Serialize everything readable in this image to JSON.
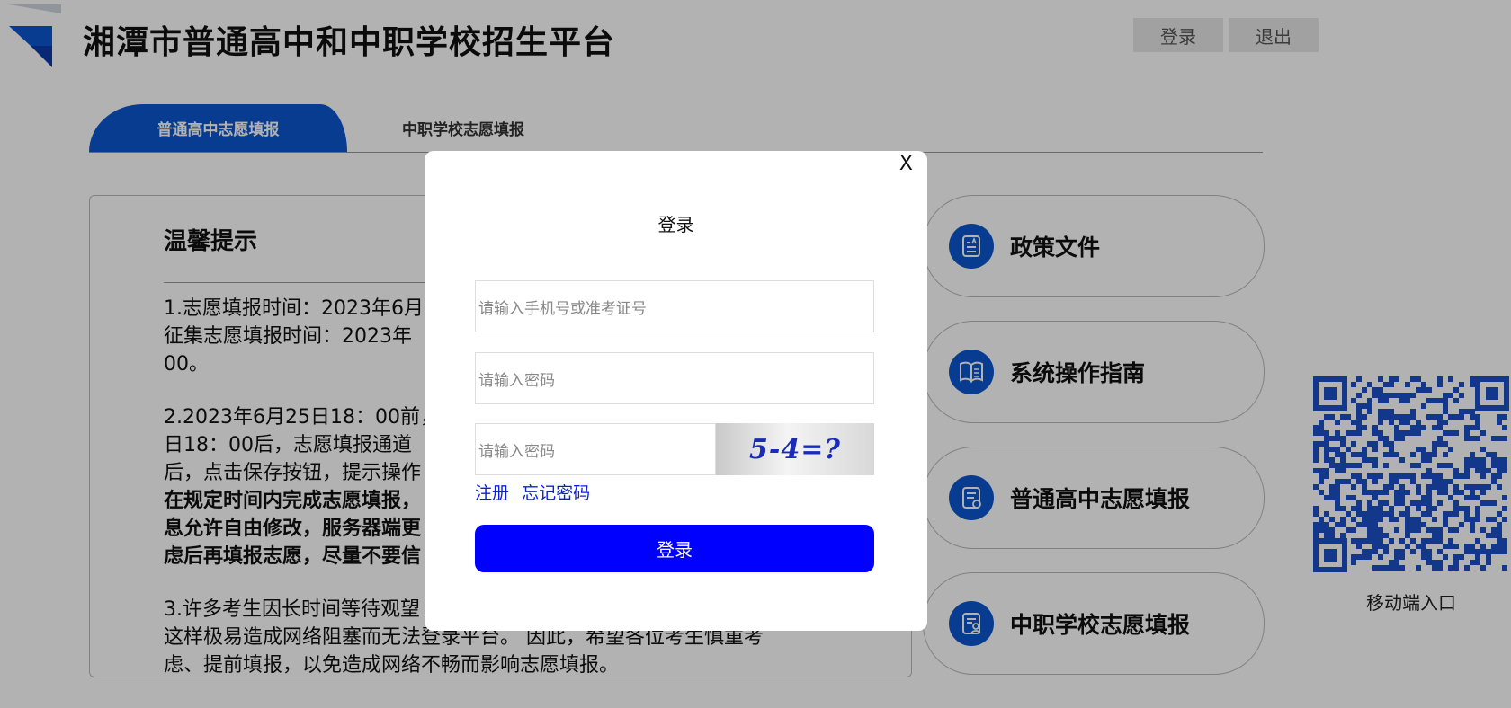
{
  "site": {
    "title": "湘潭市普通高中和中职学校招生平台"
  },
  "header": {
    "login_label": "登录",
    "logout_label": "退出"
  },
  "tabs": [
    {
      "label": "普通高中志愿填报",
      "active": true
    },
    {
      "label": "中职学校志愿填报",
      "active": false
    }
  ],
  "notice": {
    "title": "温馨提示",
    "p1": "1.志愿填报时间：2023年6月",
    "p1b": "征集志愿填报时间：2023年",
    "p1c": "00。",
    "p2": "2.2023年6月25日18：00前，",
    "p2b": "日18：00后，志愿填报通道",
    "p2c": "后，点击保存按钮，提示操作",
    "p2d": "在规定时间内完成志愿填报，",
    "p2e": "息允许自由修改，服务器端更",
    "p2f": "虑后再填报志愿，尽量不要信",
    "p3": "3.许多考生因长时间等待观望",
    "p3b": "这样极易造成网络阻塞而无法登录平台。 因此，希望各位考生慎重考",
    "p3c": "虑、提前填报，以免造成网络不畅而影响志愿填报。"
  },
  "menu": [
    {
      "label": "政策文件",
      "icon": "document-icon"
    },
    {
      "label": "系统操作指南",
      "icon": "book-icon"
    },
    {
      "label": "普通高中志愿填报",
      "icon": "form-edit-icon"
    },
    {
      "label": "中职学校志愿填报",
      "icon": "form-user-icon"
    }
  ],
  "qr": {
    "label": "移动端入口"
  },
  "modal": {
    "close_label": "X",
    "title": "登录",
    "username_placeholder": "请输入手机号或准考证号",
    "password_placeholder": "请输入密码",
    "captcha_placeholder": "请输入密码",
    "captcha_text": "5-4=?",
    "register_label": "注册",
    "forgot_label": "忘记密码",
    "submit_label": "登录"
  },
  "colors": {
    "brand_blue": "#0b57d0",
    "submit_blue": "#0000ff",
    "link_blue": "#0b1fd8"
  }
}
